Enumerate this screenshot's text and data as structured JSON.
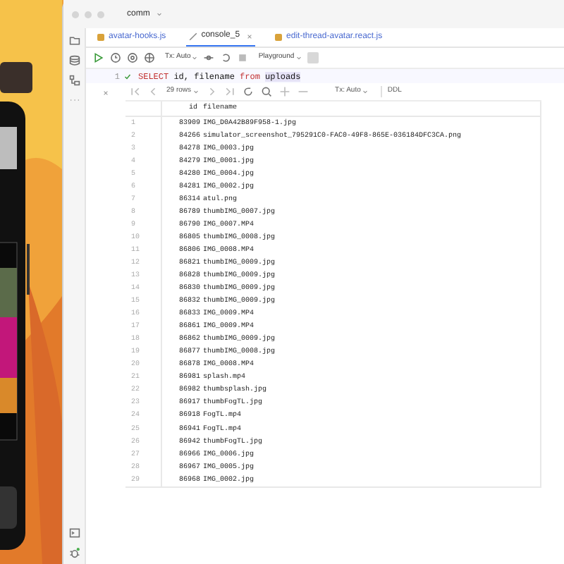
{
  "window": {
    "title": "comm"
  },
  "tabs": [
    {
      "label": "avatar-hooks.js",
      "kind": "js",
      "selected": false
    },
    {
      "label": "console_5",
      "kind": "console",
      "selected": true
    },
    {
      "label": "edit-thread-avatar.react.js",
      "kind": "js",
      "selected": false
    }
  ],
  "toolbar": {
    "tx": "Tx: Auto",
    "playground": "Playground"
  },
  "editor": {
    "line": "1",
    "keyword": "SELECT",
    "columns": "id, filename",
    "from": "from",
    "table": "uploads"
  },
  "results": {
    "rows_label": "29 rows",
    "tx": "Tx: Auto",
    "ddl": "DDL"
  },
  "table": {
    "columns": [
      "",
      "id",
      "filename"
    ],
    "rows": [
      [
        "1",
        "83909",
        "IMG_D0A42B89F958-1.jpg"
      ],
      [
        "2",
        "84266",
        "simulator_screenshot_795291C0-FAC0-49F8-865E-036184DFC3CA.png"
      ],
      [
        "3",
        "84278",
        "IMG_0003.jpg"
      ],
      [
        "4",
        "84279",
        "IMG_0001.jpg"
      ],
      [
        "5",
        "84280",
        "IMG_0004.jpg"
      ],
      [
        "6",
        "84281",
        "IMG_0002.jpg"
      ],
      [
        "7",
        "86314",
        "atul.png"
      ],
      [
        "8",
        "86789",
        "thumbIMG_0007.jpg"
      ],
      [
        "9",
        "86790",
        "IMG_0007.MP4"
      ],
      [
        "10",
        "86805",
        "thumbIMG_0008.jpg"
      ],
      [
        "11",
        "86806",
        "IMG_0008.MP4"
      ],
      [
        "12",
        "86821",
        "thumbIMG_0009.jpg"
      ],
      [
        "13",
        "86828",
        "thumbIMG_0009.jpg"
      ],
      [
        "14",
        "86830",
        "thumbIMG_0009.jpg"
      ],
      [
        "15",
        "86832",
        "thumbIMG_0009.jpg"
      ],
      [
        "16",
        "86833",
        "IMG_0009.MP4"
      ],
      [
        "17",
        "86861",
        "IMG_0009.MP4"
      ],
      [
        "18",
        "86862",
        "thumbIMG_0009.jpg"
      ],
      [
        "19",
        "86877",
        "thumbIMG_0008.jpg"
      ],
      [
        "20",
        "86878",
        "IMG_0008.MP4"
      ],
      [
        "21",
        "86981",
        "splash.mp4"
      ],
      [
        "22",
        "86982",
        "thumbsplash.jpg"
      ],
      [
        "23",
        "86917",
        "thumbFogTL.jpg"
      ],
      [
        "24",
        "86918",
        "FogTL.mp4"
      ],
      [
        "25",
        "86941",
        "FogTL.mp4"
      ],
      [
        "26",
        "86942",
        "thumbFogTL.jpg"
      ],
      [
        "27",
        "86966",
        "IMG_0006.jpg"
      ],
      [
        "28",
        "86967",
        "IMG_0005.jpg"
      ],
      [
        "29",
        "86968",
        "IMG_0002.jpg"
      ]
    ]
  }
}
